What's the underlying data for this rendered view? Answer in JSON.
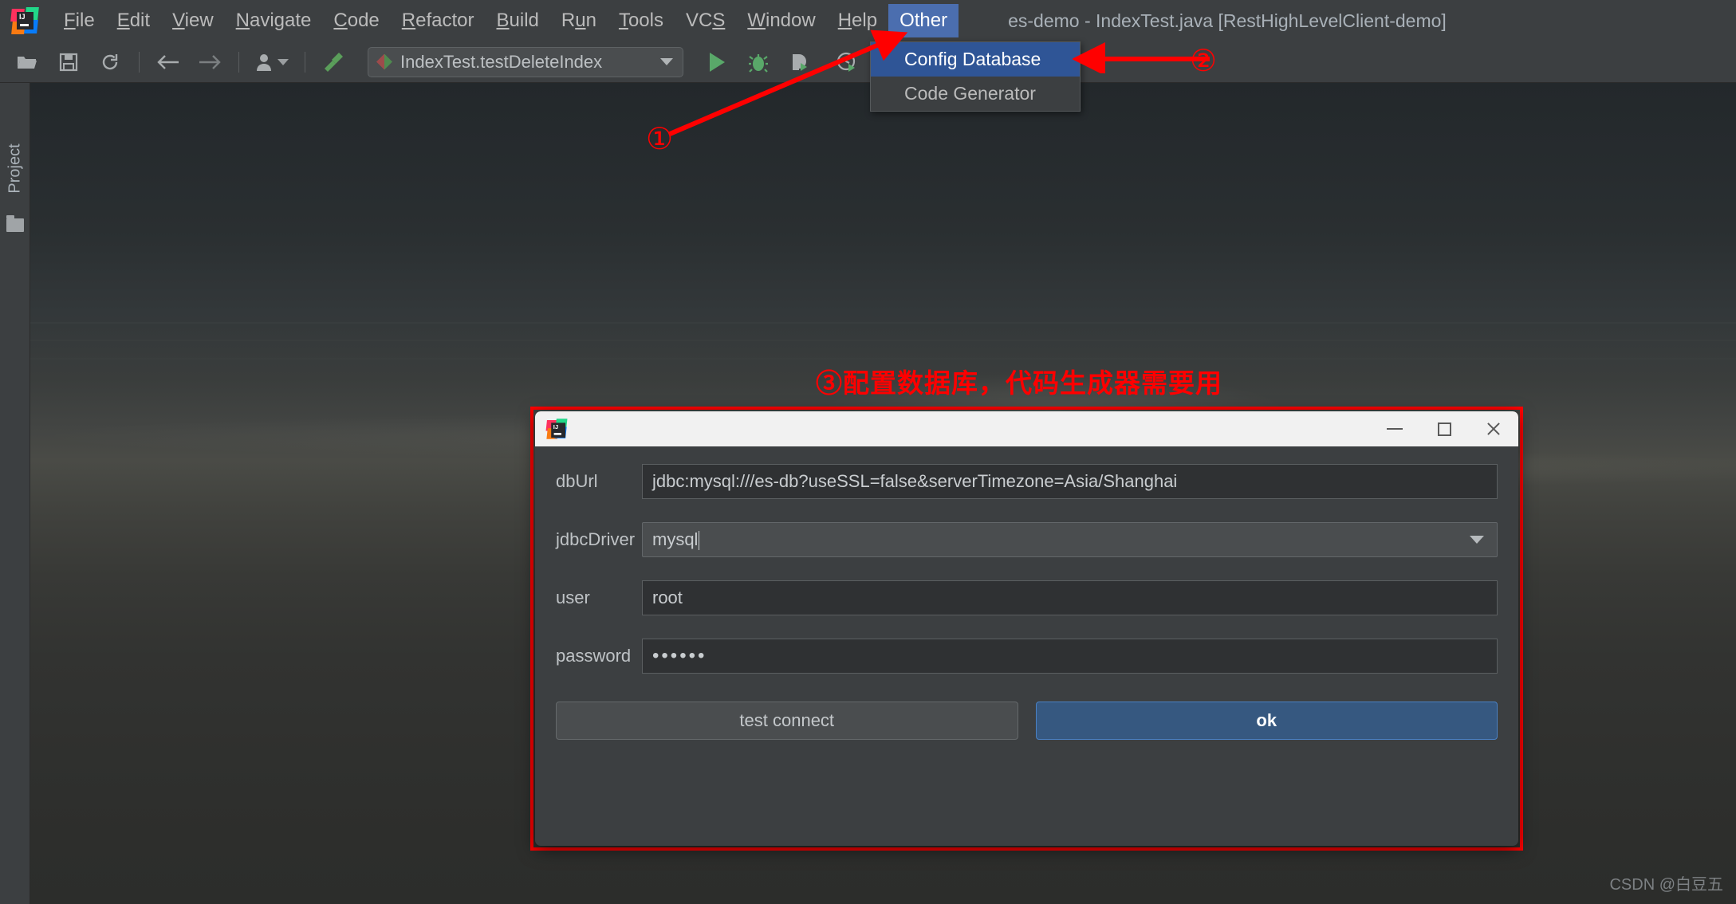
{
  "window": {
    "title": "es-demo - IndexTest.java [RestHighLevelClient-demo]"
  },
  "menubar": {
    "items": [
      {
        "label": "File",
        "mnemonic": "F"
      },
      {
        "label": "Edit",
        "mnemonic": "E"
      },
      {
        "label": "View",
        "mnemonic": "V"
      },
      {
        "label": "Navigate",
        "mnemonic": "N"
      },
      {
        "label": "Code",
        "mnemonic": "C"
      },
      {
        "label": "Refactor",
        "mnemonic": "R"
      },
      {
        "label": "Build",
        "mnemonic": "B"
      },
      {
        "label": "Run",
        "mnemonic": "n"
      },
      {
        "label": "Tools",
        "mnemonic": "T"
      },
      {
        "label": "VCS",
        "mnemonic": "S"
      },
      {
        "label": "Window",
        "mnemonic": "W"
      },
      {
        "label": "Help",
        "mnemonic": "H"
      },
      {
        "label": "Other",
        "mnemonic": ""
      }
    ],
    "active_item": "Other"
  },
  "dropdown": {
    "items": [
      {
        "label": "Config Database",
        "selected": true
      },
      {
        "label": "Code Generator",
        "selected": false
      }
    ]
  },
  "toolbar": {
    "icons": [
      "open-folder-icon",
      "save-icon",
      "sync-icon",
      "back-arrow-icon",
      "forward-arrow-icon",
      "user-icon",
      "chevron-down-icon",
      "build-hammer-icon"
    ],
    "run_configuration": "IndexTest.testDeleteIndex",
    "run_icons": [
      "run-icon",
      "debug-icon",
      "run-coverage-icon",
      "profile-icon",
      "chevron-down-icon"
    ]
  },
  "sidebar": {
    "project_label": "Project",
    "folder_icon": "folder-icon"
  },
  "annotations": {
    "marker1": "①",
    "marker2": "②",
    "note3": "③配置数据库，代码生成器需要用",
    "color": "#ff0000"
  },
  "dialog": {
    "title": "",
    "app_icon": "intellij-idea-icon",
    "window_controls": {
      "minimize": "minimize-icon",
      "maximize": "maximize-icon",
      "close": "close-icon"
    },
    "fields": [
      {
        "label": "dbUrl",
        "value": "jdbc:mysql:///es-db?useSSL=false&serverTimezone=Asia/Shanghai",
        "type": "text"
      },
      {
        "label": "jdbcDriver",
        "value": "mysql",
        "type": "combo"
      },
      {
        "label": "user",
        "value": "root",
        "type": "text"
      },
      {
        "label": "password",
        "value": "••••••",
        "type": "password"
      }
    ],
    "buttons": {
      "test_connect": "test connect",
      "ok": "ok"
    },
    "accent_color": "#365880",
    "border_color": "#ff0000"
  },
  "watermark": "CSDN @白豆五"
}
